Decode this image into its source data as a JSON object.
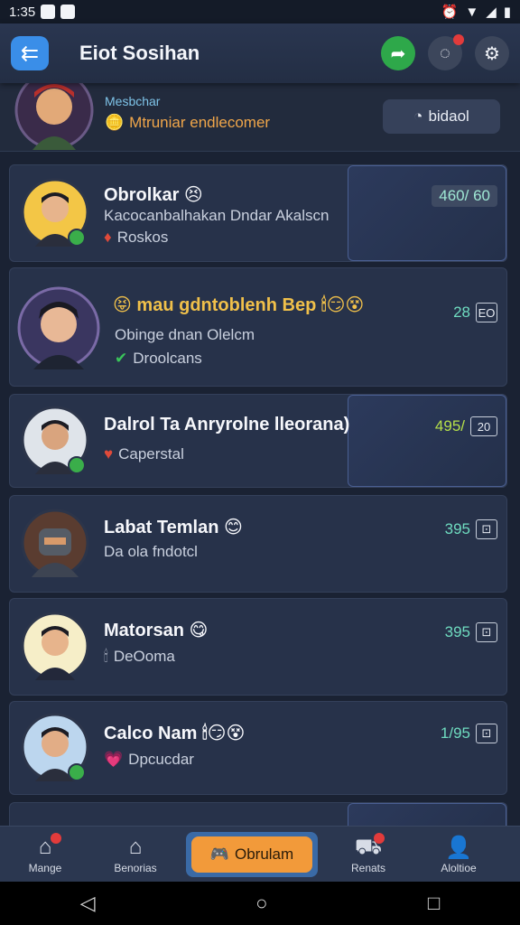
{
  "status": {
    "time": "1:35",
    "alarm": "⏰",
    "wifi": "▼",
    "signal": "◢"
  },
  "appbar": {
    "title": "Eiot Sosihan"
  },
  "pinned": {
    "line1": "Mesbchar",
    "line2": "Mtruniar endlecomer",
    "chip_label": "bidaol"
  },
  "chats": [
    {
      "name": "Obrolkar",
      "name_emoji": "😣",
      "line1": "Kacocanbalhakan Dndar Akalscn",
      "line2_icon": "♦",
      "line2": "Roskos",
      "count": "460/ 60",
      "has_badge": true
    },
    {
      "name": "mau gdntoblenh",
      "name_prefix": "😝",
      "name_suffix": "Bep",
      "name_emoji": "🕯😏😵",
      "line1": "Obinge dnan Olelcm",
      "line2_icon": "✔",
      "line2": "Droolcans",
      "count": "28",
      "count_box": "ЕО",
      "has_badge": false
    },
    {
      "name": "Dalrol Ta Anryrolne lleorana)",
      "name_emoji": "",
      "line1": "",
      "line2_icon": "♥",
      "line2": "Caperstal",
      "count": "495/",
      "count_box": "20",
      "has_badge": true
    },
    {
      "name": "Labat Temlan",
      "name_emoji": "😊",
      "line1": "",
      "line2_icon": "",
      "line2": "Da ola fndotcl",
      "count": "395",
      "count_box": "⊡",
      "has_badge": false
    },
    {
      "name": "Matorsan",
      "name_emoji": "😋",
      "line1": "",
      "line2_icon": "🕯",
      "line2": "DeOoma",
      "count": "395",
      "count_box": "⊡",
      "has_badge": false
    },
    {
      "name": "Calco Nam",
      "name_emoji": "🕯😏😵",
      "line1": "",
      "line2_icon": "💗",
      "line2": "Dpcucdar",
      "count": "1/95",
      "count_box": "⊡",
      "has_badge": true
    }
  ],
  "bottomnav": {
    "items": [
      {
        "label": "Mange",
        "icon": "⌂"
      },
      {
        "label": "Benorias",
        "icon": "⌂"
      },
      {
        "label": "Obrulam",
        "icon": "🎮"
      },
      {
        "label": "Renats",
        "icon": "⛟"
      },
      {
        "label": "Aloltioe",
        "icon": "👤"
      }
    ]
  },
  "sysnav": {
    "back": "◁",
    "home": "○",
    "recent": "□"
  }
}
